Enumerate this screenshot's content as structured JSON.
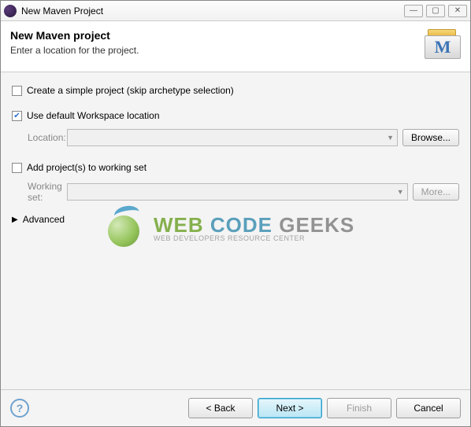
{
  "window": {
    "title": "New Maven Project"
  },
  "header": {
    "heading": "New Maven project",
    "subtitle": "Enter a location for the project.",
    "icon_letter": "M"
  },
  "options": {
    "simple_project": {
      "label": "Create a simple project (skip archetype selection)",
      "checked": false
    },
    "default_workspace": {
      "label": "Use default Workspace location",
      "checked": true
    },
    "location": {
      "label": "Location:",
      "value": "",
      "browse": "Browse..."
    },
    "working_set_cb": {
      "label": "Add project(s) to working set",
      "checked": false
    },
    "working_set": {
      "label": "Working set:",
      "value": "",
      "more": "More..."
    },
    "advanced": "Advanced"
  },
  "watermark": {
    "w1": "WEB ",
    "w2": "CODE ",
    "w3": "GEEKS",
    "sub": "WEB DEVELOPERS RESOURCE CENTER"
  },
  "footer": {
    "back": "< Back",
    "next": "Next >",
    "finish": "Finish",
    "cancel": "Cancel"
  }
}
